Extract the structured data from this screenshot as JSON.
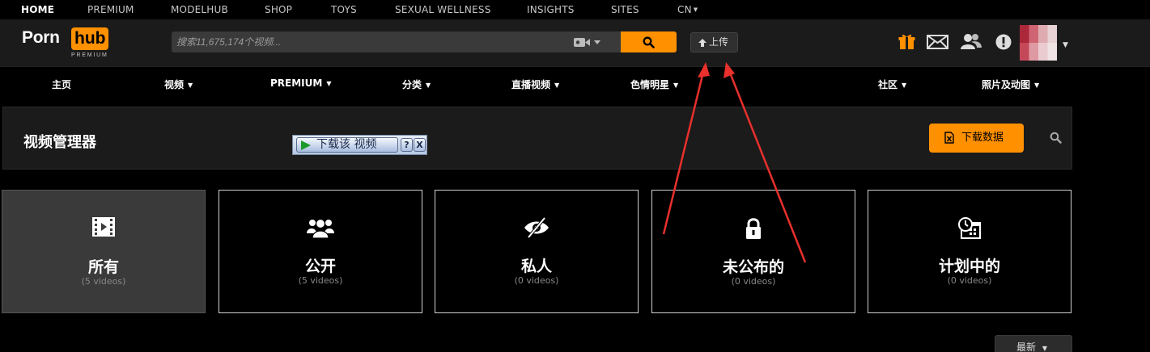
{
  "topnav": {
    "items": [
      "HOME",
      "PREMIUM",
      "MODELHUB",
      "SHOP",
      "TOYS",
      "SEXUAL WELLNESS",
      "INSIGHTS",
      "SITES",
      "CN"
    ]
  },
  "header": {
    "logo_left": "Porn",
    "logo_right": "hub",
    "logo_sub": "PREMIUM",
    "search_placeholder": "搜索11,675,174个视频...",
    "upload_label": "上传"
  },
  "nav": {
    "items": [
      "主页",
      "视频",
      "PREMIUM",
      "分类",
      "直播视频",
      "色情明星",
      "社区",
      "照片及动图"
    ]
  },
  "manager": {
    "title": "视频管理器",
    "download_video_label": "下载该 视频",
    "download_video_help": "?",
    "download_video_close": "X",
    "download_data_label": "下载数据"
  },
  "cards": [
    {
      "label": "所有",
      "count": "(5 videos)",
      "icon": "film-icon"
    },
    {
      "label": "公开",
      "count": "(5 videos)",
      "icon": "users-icon"
    },
    {
      "label": "私人",
      "count": "(0 videos)",
      "icon": "eye-slash-icon"
    },
    {
      "label": "未公布的",
      "count": "(0 videos)",
      "icon": "lock-icon"
    },
    {
      "label": "计划中的",
      "count": "(0 videos)",
      "icon": "schedule-icon"
    }
  ],
  "sort": {
    "label": "最新"
  },
  "colors": {
    "accent": "#ff9000",
    "annotation": "#e8302c"
  }
}
